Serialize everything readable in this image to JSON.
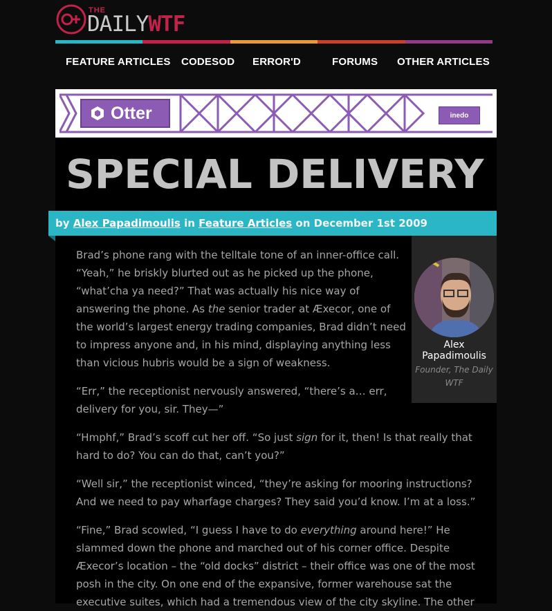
{
  "logo": {
    "the": "THE",
    "daily": "DAILY",
    "wtf": "WTF"
  },
  "colors": {
    "bar": [
      "#2ab6c4",
      "#c2224a",
      "#e59a3b",
      "#c9402a",
      "#8f3b86"
    ],
    "accent": "#2ab6c4"
  },
  "nav": [
    {
      "label": "FEATURE ARTICLES"
    },
    {
      "label": "CODESOD"
    },
    {
      "label": "ERROR'D"
    },
    {
      "label": "FORUMS"
    },
    {
      "label": "OTHER ARTICLES"
    }
  ],
  "ad": {
    "brand": "Otter",
    "sponsor": "inedo"
  },
  "article": {
    "title": "SPECIAL DELIVERY",
    "byline": {
      "by": "by",
      "author": "Alex Papadimoulis",
      "in": "in",
      "category": "Feature Articles",
      "on": "on December 1st 2009"
    },
    "author_box": {
      "name": "Alex Papadimoulis",
      "role": "Founder, The Daily WTF"
    },
    "paragraphs": [
      {
        "l1": "Brad’s phone rang with the telltale tone of an inner-office call.",
        "l2": "“Yeah,” he briskly blurted out as he picked up the phone,",
        "l3": "“what’cha ya need?” That was actually his nice way of",
        "l4a": "answering the phone. As ",
        "l4em": "the",
        "l4b": " senior trader at Æxecor, one of",
        "l5": "the world’s largest energy trading companies, Brad didn’t need",
        "l6": "to impress anyone and, in his mind, displaying anything less",
        "l7": "than vicious hubris would be a sign of weakness."
      },
      {
        "l1": "“Err,” the receptionist nervously answered, “there’s a… err,",
        "l2": "delivery for you, sir. They—”"
      },
      {
        "l1a": "“Hmphf,” Brad’s scoff cut her off. “So just ",
        "l1em": "sign",
        "l1b": " for it, then! Is that really that",
        "l2": "hard to do? You can do that, can’t you?”"
      },
      {
        "l1": "“Well sir,” the receptionist winced, “they’re asking for mooring instructions?",
        "l2": "And we need to pay wharfage charges? They said you’d know. I’m at a loss.”"
      },
      {
        "l1a": "“Fine,” Brad scowled, “I guess I have to do ",
        "l1em": "everything",
        "l1b": " around here!” He",
        "l2": "slammed down the phone and marched out of his corner office. Despite",
        "l3": "Æxecor’s location – the “old docks” district – their office was one of the most",
        "l4": "posh in the city. On one end of the expansive, former warehouse sat the",
        "l5": "executive suites, which had a tremendous view of the city skyline. The other"
      }
    ]
  }
}
